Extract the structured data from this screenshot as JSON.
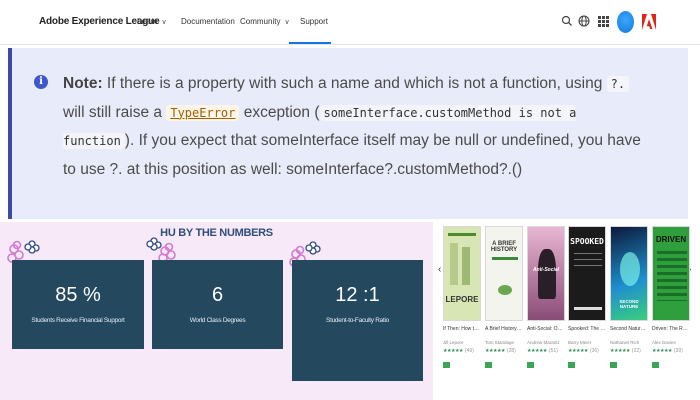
{
  "nav": {
    "brand": "Adobe Experience League",
    "items": [
      {
        "label": "Learn",
        "dropdown": true
      },
      {
        "label": "Documentation",
        "dropdown": false
      },
      {
        "label": "Community",
        "dropdown": true
      },
      {
        "label": "Support",
        "dropdown": false,
        "active": true
      }
    ],
    "icons": [
      "search-icon",
      "globe-icon",
      "apps-grid-icon",
      "user-avatar",
      "adobe-logo"
    ]
  },
  "note": {
    "lead": "Note:",
    "t1": " If there is a property with such a name and which is not a function, using ",
    "c1": "?.",
    "t2": " will still raise a ",
    "c2": "TypeError",
    "t3": " exception (",
    "c3": "someInterface.customMethod is not a function",
    "t4": "). If you expect that someInterface itself may be null or undefined, you have to use ?. at this position as well: someInterface?.customMethod?.()"
  },
  "hu": {
    "title": "HU BY THE NUMBERS",
    "stats": [
      {
        "value": "85 %",
        "label": "Students Receive Financial Support"
      },
      {
        "value": "6",
        "label": "World Class Degrees"
      },
      {
        "value": "12 :1",
        "label": "Student-to-Faculty Ratio"
      }
    ]
  },
  "carousel": {
    "prev": "‹",
    "next": "›",
    "books": [
      {
        "cover": "LEPORE",
        "title": "If Then: How the Simulmatics...",
        "author": "Jill Lepore",
        "stars": "★★★★★",
        "count": "(49)",
        "bg": "#d8e6b5"
      },
      {
        "cover": "A BRIEF HISTORY",
        "title": "A Brief History of Motion: From the...",
        "author": "Tom Standage",
        "stars": "★★★★★",
        "count": "(28)",
        "bg": "#f4f4ee"
      },
      {
        "cover": "Anti-Social",
        "title": "Anti-Social: Online Extremists, Techno...",
        "author": "Andrew Marantz",
        "stars": "★★★★★",
        "count": "(51)",
        "bg": "#c07fa8"
      },
      {
        "cover": "SPOOKED",
        "title": "Spooked: The Trump Dossier, Black Cub...",
        "author": "Barry Meier",
        "stars": "★★★★★",
        "count": "(36)",
        "bg": "#1b1b1b"
      },
      {
        "cover": "SECOND NATURE",
        "title": "Second Nature: Scenes from a World Remade",
        "author": "Nathaniel Rich",
        "stars": "★★★★★",
        "count": "(22)",
        "bg": "#27a6d9"
      },
      {
        "cover": "DRIVEN",
        "title": "Driven: The Race to Create the Autonomous...",
        "author": "Alex Davies",
        "stars": "★★★★★",
        "count": "(39)",
        "bg": "#2f9e3c"
      }
    ]
  },
  "colors": {
    "accent": "#1473e6",
    "note_bg": "#e8ebf9",
    "note_border": "#3b49a8",
    "stat_card": "#24495f",
    "hu_bg": "#f7e9f7"
  }
}
